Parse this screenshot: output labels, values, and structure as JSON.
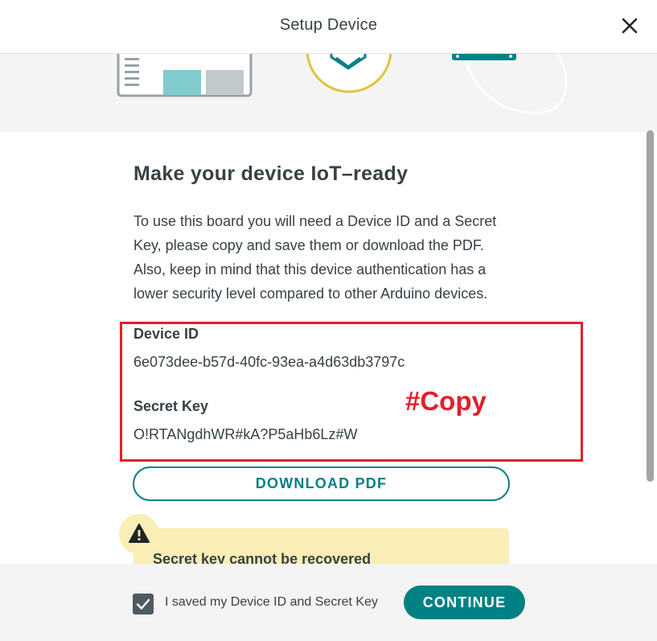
{
  "header": {
    "title": "Setup Device"
  },
  "content": {
    "heading": "Make your device IoT–ready",
    "description_lines": [
      "To use this board you will need a Device ID and a Secret",
      "Key, please copy and save them or download the PDF.",
      "Also, keep in mind that this device authentication has a",
      "lower security level compared to other Arduino devices."
    ],
    "device_id_label": "Device ID",
    "device_id_value": "6e073dee-b57d-40fc-93ea-a4d63db3797c",
    "secret_key_label": "Secret Key",
    "secret_key_value": "O!RTANgdhWR#kA?P5aHb6Lz#W",
    "annotation": "#Copy",
    "download_label": "DOWNLOAD PDF",
    "warning_text": "Secret key cannot be recovered"
  },
  "footer": {
    "checkbox_label": "I saved my Device ID and Secret Key",
    "checkbox_checked": true,
    "continue_label": "CONTINUE"
  },
  "colors": {
    "accent": "#008184",
    "annotation_red": "#e0202b",
    "warning_bg": "#f9eeb5",
    "text": "#374146"
  },
  "icons": [
    "close-icon",
    "board-illustration",
    "shield-illustration",
    "device-illustration",
    "warning-icon",
    "check-icon"
  ]
}
